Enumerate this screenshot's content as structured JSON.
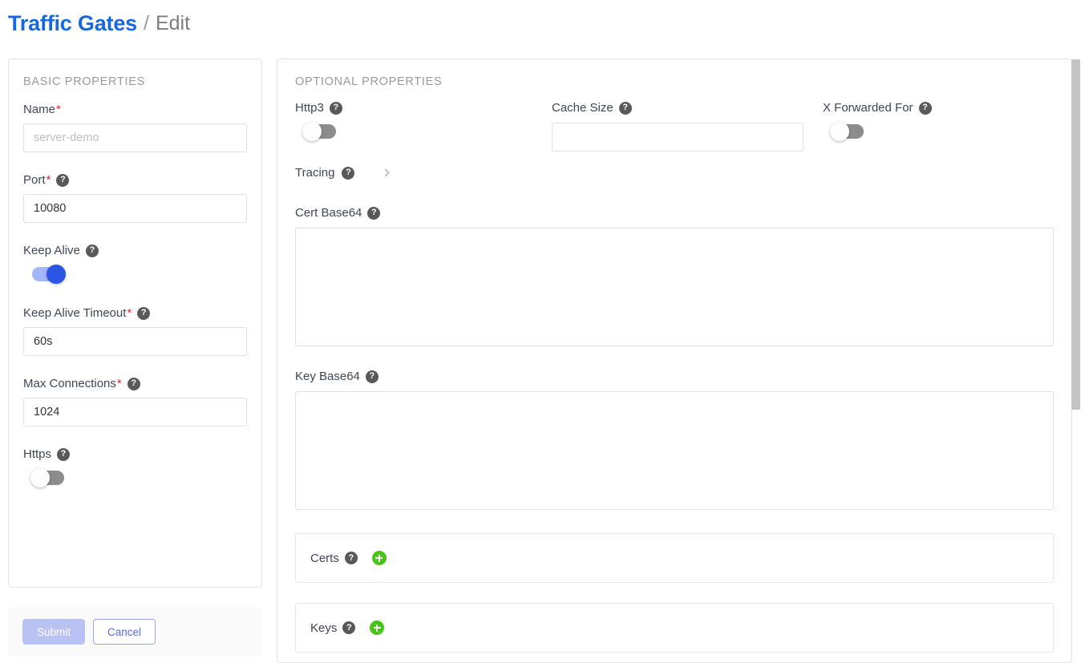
{
  "breadcrumb": {
    "root_label": "Traffic Gates",
    "separator": "/",
    "current_label": "Edit"
  },
  "colors": {
    "link_blue": "#1868dd",
    "toggle_on_track": "#a3b6f7",
    "toggle_on_knob": "#2a55e5",
    "toggle_off_track": "#8c8c8c",
    "add_green": "#49c41a",
    "submit_disabled": "#b9c2f2",
    "cancel_border": "#9aa7ea",
    "required_star": "#f5222d"
  },
  "icons": {
    "help": "?",
    "chevron_right": "chevron-right-icon",
    "plus": "+"
  },
  "basic_properties": {
    "section_title": "BASIC PROPERTIES",
    "name": {
      "label": "Name",
      "required": "*",
      "value": "",
      "placeholder": "server-demo"
    },
    "port": {
      "label": "Port",
      "required": "*",
      "value": "10080",
      "placeholder": ""
    },
    "keep_alive": {
      "label": "Keep Alive",
      "state": "on"
    },
    "keep_alive_timeout": {
      "label": "Keep Alive Timeout",
      "required": "*",
      "value": "60s",
      "placeholder": ""
    },
    "max_connections": {
      "label": "Max Connections",
      "required": "*",
      "value": "1024",
      "placeholder": ""
    },
    "https": {
      "label": "Https",
      "state": "off"
    }
  },
  "footer": {
    "submit_label": "Submit",
    "cancel_label": "Cancel"
  },
  "optional_properties": {
    "section_title": "OPTIONAL PROPERTIES",
    "http3": {
      "label": "Http3",
      "state": "off"
    },
    "cache_size": {
      "label": "Cache Size",
      "value": "",
      "placeholder": ""
    },
    "x_forwarded_for": {
      "label": "X Forwarded For",
      "state": "off"
    },
    "tracing": {
      "label": "Tracing"
    },
    "cert_base64": {
      "label": "Cert Base64",
      "value": "",
      "placeholder": ""
    },
    "key_base64": {
      "label": "Key Base64",
      "value": "",
      "placeholder": ""
    },
    "certs": {
      "label": "Certs"
    },
    "keys": {
      "label": "Keys"
    }
  }
}
